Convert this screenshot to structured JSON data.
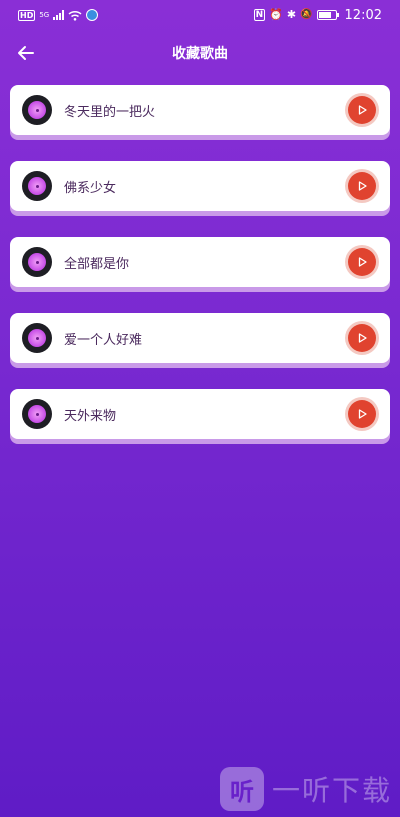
{
  "status_bar": {
    "hd": "HD",
    "net": "5G",
    "nfc": "N",
    "alarm": "⏰",
    "bluetooth": "✱",
    "mute": "🔕",
    "time": "12:02"
  },
  "header": {
    "title": "收藏歌曲"
  },
  "songs": [
    {
      "title": "冬天里的一把火"
    },
    {
      "title": "佛系少女"
    },
    {
      "title": "全部都是你"
    },
    {
      "title": "爱一个人好难"
    },
    {
      "title": "天外来物"
    }
  ],
  "watermark": {
    "logo_char": "听",
    "text": "一听下载"
  },
  "colors": {
    "bg_top": "#8a2fd6",
    "bg_bottom": "#5f1cc6",
    "play_red": "#e0432f",
    "card_shadow": "#c99ae8"
  }
}
